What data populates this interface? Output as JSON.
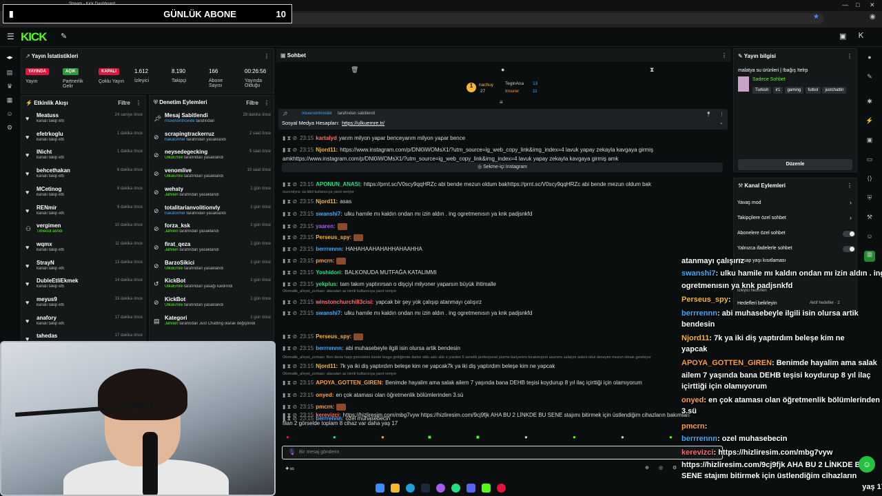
{
  "browser": {
    "tab_title": "Stream - Kick Dashboard",
    "url": "https://dashboard.kick.com/stream"
  },
  "overlay_abone": {
    "label": "GÜNLÜK ABONE",
    "count": "10"
  },
  "header": {
    "logo": "KICK"
  },
  "stats": {
    "title": "Yayın İstatistikleri",
    "items": [
      {
        "badge": "YAYINDA",
        "label": "Yayın",
        "color": "#e0153d"
      },
      {
        "badge": "AÇIK",
        "label": "Partnerlik Gelir",
        "color": "#2a9d3a"
      },
      {
        "badge": "KAPALI",
        "label": "Çoklu Yayın",
        "color": "#e0153d"
      },
      {
        "value": "1.612",
        "label": "İzleyici"
      },
      {
        "value": "8.190",
        "label": "Takipçi"
      },
      {
        "value": "166",
        "label": "Abone Sayısı"
      },
      {
        "value": "00:26:56",
        "label": "Yayında Olduğu"
      }
    ]
  },
  "activity": {
    "title": "Etkinlik Akışı",
    "filter": "Filtre",
    "items": [
      {
        "name": "Meatuss",
        "sub": "kanalı takip etti",
        "time": "24 saniye önce"
      },
      {
        "name": "efetrkoglu",
        "sub": "kanalı takip etti",
        "time": "1 dakika önce"
      },
      {
        "name": "INicht",
        "sub": "kanalı takip etti",
        "time": "1 dakika önce"
      },
      {
        "name": "behcethakan",
        "sub": "kanalı takip etti",
        "time": "6 dakika önce"
      },
      {
        "name": "MCetinog",
        "sub": "kanalı takip etti",
        "time": "8 dakika önce"
      },
      {
        "name": "RENmir",
        "sub": "kanalı takip etti",
        "time": "9 dakika önce"
      },
      {
        "name": "vergimen",
        "sub": "Timeout alındı",
        "time": "10 dakika önce"
      },
      {
        "name": "wqmx",
        "sub": "kanalı takip etti",
        "time": "11 dakika önce"
      },
      {
        "name": "StrayN",
        "sub": "kanalı takip etti",
        "time": "13 dakika önce"
      },
      {
        "name": "DubleEtliEkmek",
        "sub": "kanalı takip etti",
        "time": "14 dakika önce"
      },
      {
        "name": "meyus9",
        "sub": "kanalı takip etti",
        "time": "15 dakika önce"
      },
      {
        "name": "anafory",
        "sub": "kanalı takip etti",
        "time": "17 dakika önce"
      },
      {
        "name": "tahedas",
        "sub": "",
        "time": "17 dakika önce"
      }
    ]
  },
  "moderation": {
    "title": "Denetim Eylemleri",
    "filter": "Filtre",
    "items": [
      {
        "name": "Mesaj Sabitlendi",
        "actor": "msxenontrioxide",
        "sub": "tarafından",
        "time": "28 dakika önce"
      },
      {
        "name": "scrapingtrackerruz",
        "actor": "hakatonher",
        "sub": "tarafından yasaklandı",
        "time": "2 saat önce"
      },
      {
        "name": "neysedegecking",
        "actor": "UlkuEmre",
        "sub": "tarafından yasaklandı",
        "time": "5 saat önce"
      },
      {
        "name": "venomlive",
        "actor": "UlkuEmre",
        "sub": "tarafından yasaklandı",
        "time": "10 saat önce"
      },
      {
        "name": "wehaty",
        "actor": "Jahrein",
        "sub": "tarafından yasaklandı",
        "time": "1 gün önce"
      },
      {
        "name": "totalitarianvolitionvly",
        "actor": "hakatonher",
        "sub": "tarafından yasaklandı",
        "time": "1 gün önce"
      },
      {
        "name": "forza_ksk",
        "actor": "Jahrein",
        "sub": "tarafından yasaklandı",
        "time": "1 gün önce"
      },
      {
        "name": "firat_qeza",
        "actor": "Jahrein",
        "sub": "tarafından yasaklandı",
        "time": "1 gün önce"
      },
      {
        "name": "BarzoSikici",
        "actor": "UlkuEmre",
        "sub": "tarafından yasaklandı",
        "time": "1 gün önce"
      },
      {
        "name": "KickBot",
        "actor": "UlkuEmre",
        "sub": "tarafından yasağı kaldırıldı",
        "time": "1 gün önce"
      },
      {
        "name": "KickBot",
        "actor": "UlkuEmre",
        "sub": "tarafından yasaklandı",
        "time": "1 gün önce"
      },
      {
        "name": "Kategori",
        "actor": "Jahrein",
        "sub": "tarafından Just Chatting olarak değiştirildi",
        "time": "1 gün önce"
      }
    ]
  },
  "chat": {
    "title": "Sohbet",
    "top_user1": "nachuy",
    "top_user1_count": "27",
    "top_user2": "TeginAna",
    "top_user2_count": "13",
    "top_user3": "Insurer",
    "top_user3_count": "11",
    "pinned_by": "msxenontrioxide",
    "pinned_by_suffix": "tarafından sabitlendi",
    "pinned_text": "Sosyal Medya Hesapları:",
    "pinned_link": "https://ulkuemre.tr/",
    "embed_label": "Sekme-içi Instagram",
    "input_placeholder": "Bir mesaj gönderin",
    "lines": [
      {
        "ts": "23:15",
        "user": "kartalyd",
        "color": "#ff6b6b",
        "text": "yarım milyon yapar benceyarım milyon yapar bence"
      },
      {
        "ts": "23:15",
        "user": "Njord11:",
        "color": "#f7b731",
        "text": "https://www.instagram.com/p/DNl0iWOMsX1/?utm_source=ig_web_copy_link&img_index=4 lavuk yapay zekayla kavgaya girmiş"
      },
      {
        "ts": "",
        "user": "",
        "color": "#ddd",
        "text": "amkhttps://www.instagram.com/p/DNl0iWOMsX1/?utm_source=ig_web_copy_link&img_index=4 lavuk yapay zekayla kavgaya girmiş amk"
      },
      {
        "ts": "23:15",
        "user": "APONUN_ANASI:",
        "color": "#26de81",
        "text": "https://prnt.sc/V0scy9qqHRZc abi bende mezun oldum bakhttps://prnt.sc/V0scy9qqHRZc abi bende mezun oldum bak"
      },
      {
        "ts": "23:15",
        "user": "Njord11:",
        "color": "#f7b731",
        "text": "asas"
      },
      {
        "ts": "23:15",
        "user": "swanshi7:",
        "color": "#45aaf2",
        "text": "ulku hamile mı kaldın ondan mı izin aldın . ing ogretmenısın ya knk padjsnkfd"
      },
      {
        "ts": "23:15",
        "user": "yaaren:",
        "color": "#a55eea",
        "text": ""
      },
      {
        "ts": "23:15",
        "user": "Perseus_spy:",
        "color": "#f7b731",
        "text": ""
      },
      {
        "ts": "23:15",
        "user": "berrrennn:",
        "color": "#45aaf2",
        "text": "HAHAHAAHAHAHHAHAAHHA"
      },
      {
        "ts": "23:15",
        "user": "pmcrn:",
        "color": "#ff9f43",
        "text": ""
      },
      {
        "ts": "23:15",
        "user": "Yoshidori:",
        "color": "#26de81",
        "text": "BALKONUDA MUTFAĞA KATALIMMI"
      },
      {
        "ts": "23:15",
        "user": "yekplus:",
        "color": "#26de81",
        "text": "tam takım yaptırırsan o dişçiyi milyoner yaparsın büyük ihtimalle"
      },
      {
        "ts": "23:15",
        "user": "winstonchurchill3cisi:",
        "color": "#ff6b6b",
        "text": "yapcak bir şey yok çalışıp atanmayı çalışırz"
      },
      {
        "ts": "23:15",
        "user": "swanshi7:",
        "color": "#45aaf2",
        "text": "ulku hamile mı kaldın ondan mı izin aldın . ing ogretmenısın ya knk padjsnkfd"
      },
      {
        "ts": "23:15",
        "user": "Perseus_spy:",
        "color": "#f7b731",
        "text": ""
      },
      {
        "ts": "23:15",
        "user": "berrrennn:",
        "color": "#45aaf2",
        "text": "abi muhasebeyle ilgili isin olursa artik bendesin"
      },
      {
        "ts": "23:15",
        "user": "Njord11:",
        "color": "#f7b731",
        "text": "7k ya iki diş yaptırdım beleşe kim ne yapcak7k ya iki diş yaptırdım beleşe kim ne yapcak"
      },
      {
        "ts": "23:15",
        "user": "APOYA_GOTTEN_GIREN:",
        "color": "#ff9f43",
        "text": "Benimde hayalim ama salak ailem 7 yaşında bana DEHB teşisi koydurup 8 yıl ilaç içirttiği için olamıyorum"
      },
      {
        "ts": "23:15",
        "user": "onyed:",
        "color": "#ff9f43",
        "text": "en çok ataması olan öğretmenlik bölümlerinden 3.sü"
      },
      {
        "ts": "23:15",
        "user": "pmcrn:",
        "color": "#ff9f43",
        "text": ""
      },
      {
        "ts": "23:15",
        "user": "berrrennn:",
        "color": "#45aaf2",
        "text": "ozel muhasebecin"
      },
      {
        "ts": "23:15",
        "user": "kerevizci:",
        "color": "#ff6b6b",
        "text": "https://hizliresim.com/mbg7vyw https://hizliresim.com/9cj9fjk AHA BU 2 LİNKDE BU SENE stajımı bitirmek için üstlendiğim cihazların bakımları"
      },
      {
        "ts": "",
        "user": "",
        "color": "#ddd",
        "text": "filan 2 görselde toplam 8 cihaz var daha yaş 17"
      }
    ],
    "sys": [
      "ouzcnkyra: sa kibil kullanıcıya yanıt veriyor",
      "Otomatik_ahiyet_zorbası: atanaları az isimli kullanıcıya yanıt veriyor",
      "Otomatik_ahiyet_zorbası: Ben deniz harp girecektim lisede teoga girdiğimde darbe oldu askı aldı o yüzden 5 senelik profesyonel yüzme kariyerimi bırakmıştım asanımı salaiym askeri okul deneyim mezun olmak gerekiyor",
      "Otomatik_ahiyet_zorbası: atanaları az isimli kullanıcıya yanıt veriyor"
    ]
  },
  "stream_info": {
    "title": "Yayın bilgisi",
    "stream_title": "malatya su ürünleri | !bağış !telrp",
    "mode": "Sadece Sohbet",
    "tags": [
      "Turkish",
      "ir1",
      "gaming",
      "futbol",
      "justchattin"
    ],
    "edit_button": "Düzenle"
  },
  "channel_actions": {
    "title": "Kanal Eylemleri",
    "items": [
      "Yavaş mod",
      "Takipçilere özel sohbet",
      "Abonelere özel sohbet",
      "Yalnızca ifadelerle sohbet",
      "Hesap yaşı kısıtlaması",
      "İzleyici hedefleri",
      "Hedefleri belirleyin"
    ],
    "active_goals": "Aktif hedefler · 2"
  },
  "overlay_chat": [
    {
      "user": "",
      "text": "atanmayı çalışırız",
      "color": "#fff"
    },
    {
      "user": "swanshi7",
      "text": ": ulku hamile mı kaldın ondan mı izin aldın . ing",
      "color": "#45aaf2"
    },
    {
      "user": "",
      "text": "ogretmenısın ya knk padjsnkfd",
      "color": "#fff"
    },
    {
      "user": "Perseus_spy",
      "text": ":",
      "color": "#f7b731"
    },
    {
      "user": "berrrennn",
      "text": ": abi muhasebeyle ilgili isin olursa artik",
      "color": "#45aaf2"
    },
    {
      "user": "",
      "text": "bendesin",
      "color": "#fff"
    },
    {
      "user": "Njord11",
      "text": ": 7k ya iki diş yaptırdım beleşe kim ne",
      "color": "#f7b731"
    },
    {
      "user": "",
      "text": "yapcak",
      "color": "#fff"
    },
    {
      "user": "APOYA_GOTTEN_GIREN",
      "text": ": Benimde hayalim ama salak",
      "color": "#ff9f43"
    },
    {
      "user": "",
      "text": "ailem 7 yaşında bana DEHB teşisi koydurup 8 yıl ilaç",
      "color": "#fff"
    },
    {
      "user": "",
      "text": "içirttiği için olamıyorum",
      "color": "#fff"
    },
    {
      "user": "onyed",
      "text": ": en çok ataması olan öğretmenlik bölümlerinden",
      "color": "#ff9f43"
    },
    {
      "user": "",
      "text": "3.sü",
      "color": "#fff"
    },
    {
      "user": "pmcrn",
      "text": ":",
      "color": "#ff9f43"
    },
    {
      "user": "berrrennn",
      "text": ": ozel muhasebecin",
      "color": "#45aaf2"
    },
    {
      "user": "kerevizci",
      "text": ": https://hizliresim.com/mbg7vyw",
      "color": "#ff6b6b"
    },
    {
      "user": "",
      "text": "https://hizliresim.com/9cj9fjk AHA BU 2 LİNKDE BU",
      "color": "#fff"
    },
    {
      "user": "",
      "text": "SENE stajımı bitirmek için üstlendiğim cihazların",
      "color": "#fff"
    },
    {
      "user": "",
      "text": "bakımları filan 2 görselde toplam 8 cihaz var daha yaş 17",
      "color": "#fff"
    }
  ],
  "colors": {
    "accent": "#53fc18",
    "live": "#e0153d",
    "panel": "#141819"
  }
}
